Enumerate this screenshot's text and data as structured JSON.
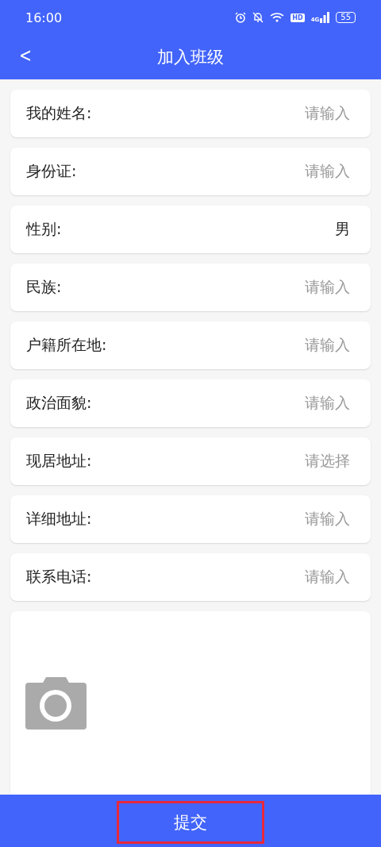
{
  "status_bar": {
    "time": "16:00",
    "network": "4G",
    "hd": "HD",
    "battery": "55"
  },
  "header": {
    "back": "<",
    "title": "加入班级"
  },
  "fields": [
    {
      "label": "我的姓名:",
      "placeholder": "请输入"
    },
    {
      "label": "身份证:",
      "placeholder": "请输入"
    },
    {
      "label": "性别:",
      "value": "男"
    },
    {
      "label": "民族:",
      "placeholder": "请输入"
    },
    {
      "label": "户籍所在地:",
      "placeholder": "请输入"
    },
    {
      "label": "政治面貌:",
      "placeholder": "请输入"
    },
    {
      "label": "现居地址:",
      "placeholder": "请选择"
    },
    {
      "label": "详细地址:",
      "placeholder": "请输入"
    },
    {
      "label": "联系电话:",
      "placeholder": "请输入"
    }
  ],
  "photo_upload": {
    "kind": "camera"
  },
  "submit": {
    "label": "提交",
    "highlighted": true
  }
}
